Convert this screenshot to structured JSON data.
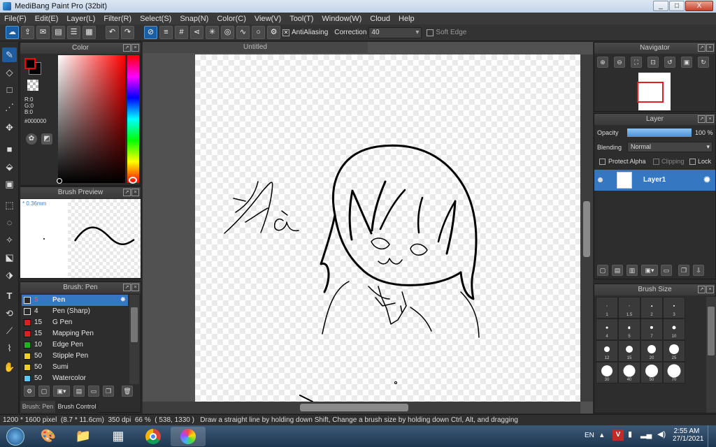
{
  "window": {
    "title": "MediBang Paint Pro (32bit)",
    "minimize": "_",
    "maximize": "□",
    "close": "X"
  },
  "menu": [
    "File(F)",
    "Edit(E)",
    "Layer(L)",
    "Filter(R)",
    "Select(S)",
    "Snap(N)",
    "Color(C)",
    "View(V)",
    "Tool(T)",
    "Window(W)",
    "Cloud",
    "Help"
  ],
  "toolbar": {
    "antialias_label": "AntiAliasing",
    "antialias_checked": "✕",
    "correction_label": "Correction",
    "correction_value": "40",
    "softedge_label": "Soft Edge"
  },
  "color_panel": {
    "title": "Color",
    "r": "R:0",
    "g": "G:0",
    "b": "B:0",
    "hex": "#000000",
    "primary": "#000000",
    "secondary": "#ff0000"
  },
  "brush_preview": {
    "title": "Brush Preview",
    "size_label": "* 0.36mm"
  },
  "brush_list": {
    "title": "Brush: Pen",
    "items": [
      {
        "size": "5",
        "name": "Pen",
        "color": "#2a2a2a"
      },
      {
        "size": "4",
        "name": "Pen (Sharp)",
        "color": "#2a2a2a"
      },
      {
        "size": "15",
        "name": "G Pen",
        "color": "#e02020"
      },
      {
        "size": "15",
        "name": "Mapping Pen",
        "color": "#e02020"
      },
      {
        "size": "10",
        "name": "Edge Pen",
        "color": "#20b020"
      },
      {
        "size": "50",
        "name": "Stipple Pen",
        "color": "#f0d020"
      },
      {
        "size": "50",
        "name": "Sumi",
        "color": "#f0d020"
      },
      {
        "size": "50",
        "name": "Watercolor",
        "color": "#5ac8f0"
      }
    ],
    "tabs": [
      "Brush: Pen",
      "Brush Control"
    ]
  },
  "canvas": {
    "tab_title": "Untitled"
  },
  "navigator": {
    "title": "Navigator"
  },
  "layer_panel": {
    "title": "Layer",
    "opacity_label": "Opacity",
    "opacity_value": "100 %",
    "opacity": 1.0,
    "blending_label": "Blending",
    "blending_value": "Normal",
    "protect_alpha": "Protect Alpha",
    "clipping": "Clipping",
    "lock": "Lock",
    "layers": [
      {
        "name": "Layer1"
      }
    ]
  },
  "brush_size": {
    "title": "Brush Size",
    "sizes": [
      "1",
      "1.5",
      "2",
      "3",
      "4",
      "5",
      "7",
      "10",
      "12",
      "15",
      "20",
      "25",
      "30",
      "40",
      "50",
      "70"
    ]
  },
  "status_bar": {
    "pixel": "1200 * 1600 pixel",
    "cm": "(8.7 * 11.6cm)",
    "dpi": "350 dpi",
    "zoom": "66 %",
    "coords": "( 538, 1330 )",
    "hint": "Draw a straight line by holding down Shift, Change a brush size by holding down Ctrl, Alt, and dragging"
  },
  "taskbar": {
    "lang": "EN",
    "time": "2:55 AM",
    "date": "27/1/2021"
  }
}
